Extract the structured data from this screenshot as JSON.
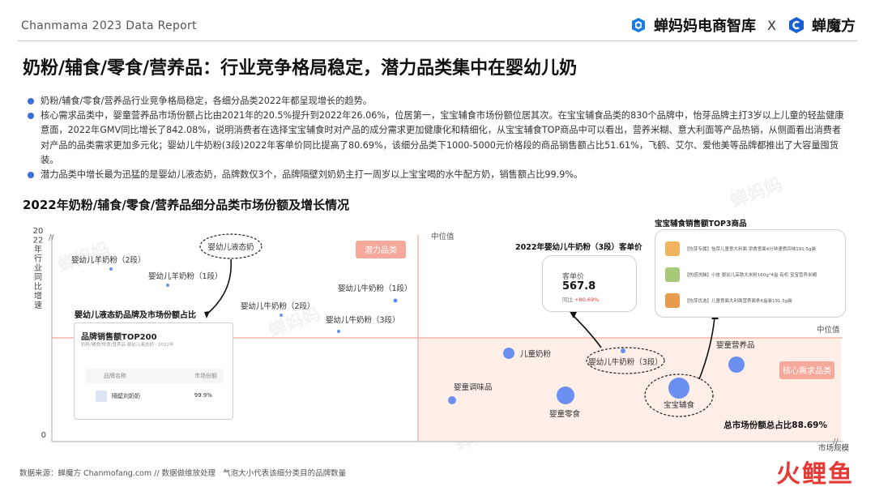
{
  "header": {
    "report_label": "Chanmama 2023 Data Report",
    "brand_left": "蝉妈妈电商智库",
    "brand_separator": "X",
    "brand_right": "蝉魔方"
  },
  "title": "奶粉/辅食/零食/营养品：行业竞争格局稳定，潜力品类集中在婴幼儿奶",
  "bullets": [
    "奶粉/辅食/零食/营养品行业竞争格局稳定，各细分品类2022年都呈现增长的趋势。",
    "核心需求品类中，婴童营养品市场份额占比由2021年的20.5%提升到2022年26.06%，位居第一，宝宝辅食市场份额位居其次。在宝宝辅食品类的830个品牌中，怡芽品牌主打3岁以上儿童的轻盐健康意面，2022年GMV同比增长了842.08%，说明消费者在选择宝宝辅食时对产品的成分需求更加健康化和精细化，从宝宝辅食TOP商品中可以看出，营养米糊、意大利面等产品热销，从侧面看出消费者对产品的品类需求更加多元化；婴幼儿牛奶粉(3段)2022年客单价同比提高了80.69%，该细分品类下1000-5000元价格段的商品销售额占比51.61%，飞鹤、艾尔、爱他美等品牌都推出了大容量囤货装。",
    "潜力品类中增长最为迅猛的是婴幼儿液态奶，品牌数仅3个，品牌隔壁刘奶奶主打一周岁以上宝宝喝的水牛配方奶，销售额占比99.9%。"
  ],
  "chart_data": {
    "type": "scatter",
    "title": "2022年奶粉/辅食/零食/营养品细分品类市场份额及增长情况",
    "xlabel": "市场规模",
    "ylabel": "2022年行业同比增速",
    "y_origin_label": "0",
    "x_ref_label": "中位值",
    "y_ref_label": "中位值",
    "quadrant_labels": {
      "top_left": "潜力品类",
      "bottom_right": "核心需求品类"
    },
    "note": "气泡大小代表该细分类目的品牌数量",
    "points": [
      {
        "name": "婴幼儿羊奶粉（2段）",
        "quadrant": "potential",
        "size": "xs"
      },
      {
        "name": "婴幼儿液态奶",
        "quadrant": "potential",
        "size": "none",
        "highlight": true
      },
      {
        "name": "婴幼儿羊奶粉（1段）",
        "quadrant": "potential",
        "size": "xs"
      },
      {
        "name": "婴幼儿牛奶粉（2段）",
        "quadrant": "potential",
        "size": "xs"
      },
      {
        "name": "婴幼儿牛奶粉（1段）",
        "quadrant": "potential",
        "size": "xs"
      },
      {
        "name": "婴幼儿牛奶粉（3段）",
        "quadrant": "potential",
        "size": "xs"
      },
      {
        "name": "儿童奶粉",
        "quadrant": "core",
        "size": "m"
      },
      {
        "name": "婴幼儿牛奶粉（3段）",
        "quadrant": "core",
        "size": "xs",
        "highlight": true
      },
      {
        "name": "婴童营养品",
        "quadrant": "core",
        "size": "l"
      },
      {
        "name": "婴童调味品",
        "quadrant": "core",
        "size": "s"
      },
      {
        "name": "婴童零食",
        "quadrant": "core",
        "size": "l"
      },
      {
        "name": "宝宝辅食",
        "quadrant": "core",
        "size": "xl",
        "highlight": true
      }
    ],
    "total_share_label": "总市场份额总占比88.69%"
  },
  "liquid_milk_card": {
    "heading": "婴幼儿液态奶品牌及市场份额占比",
    "title": "品牌销售额TOP200",
    "subtitle": "奶粉/辅食/零食/营养品·婴幼儿液态奶 · 2022年",
    "col_brand": "品牌名称",
    "col_share": "市场份额",
    "row_brand": "隔壁刘奶奶",
    "row_share": "99.9%"
  },
  "price_card": {
    "heading": "2022年婴幼儿牛奶粉（3段）客单价",
    "label": "客单价",
    "value": "567.8",
    "yoy_label": "同比",
    "yoy_value": "+80.69%"
  },
  "top3_card": {
    "heading": "宝宝辅食销售额TOP3商品",
    "items": [
      "【怡芽专属】怡芽儿童意大利面 添食意面4分钟速煮四味191.5g装",
      "【伤感洗脑】小皮 婴幼儿高铁大米粉160g*4盒 有机 宝宝营养米糊",
      "【怡芽优选】儿童意面大利面营养面条6盒装191.5g装"
    ]
  },
  "footer": {
    "source": "数据来源：蝉魔方 Chanmofang.com // 数据做维放处理",
    "note": "气泡大小代表该细分类目的品牌数量"
  },
  "corner_brand": "火鲤鱼",
  "colors": {
    "accent_blue": "#3a6fd8",
    "bubble_fill": "#6b8ff0",
    "quadrant_pink": "#fdeee8",
    "median_line": "#f2a79c",
    "badge_fill": "#f6a89a",
    "dashed": "#222222"
  }
}
